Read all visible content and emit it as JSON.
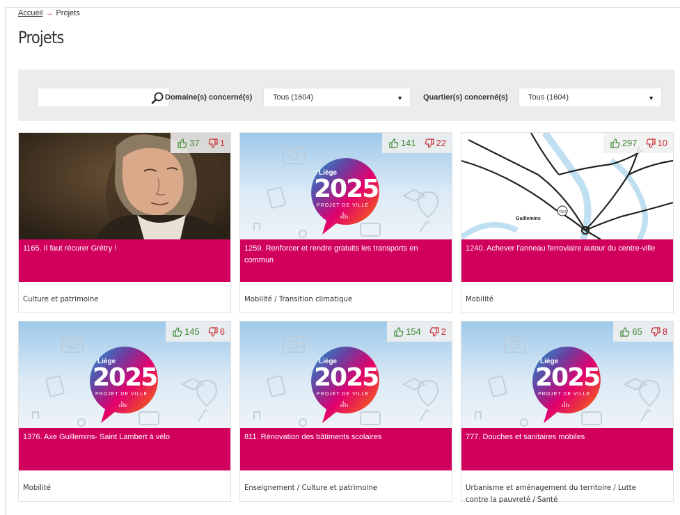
{
  "breadcrumb": {
    "home": "Accueil",
    "arrow": "→",
    "current": "Projets"
  },
  "page_title": "Projets",
  "filters": {
    "search_value": "",
    "domain_label": "Domaine(s) concerné(s)",
    "domain_value": "Tous (1604)",
    "district_label": "Quartier(s) concerné(s)",
    "district_value": "Tous (1604)"
  },
  "logo": {
    "line1": "Liège",
    "line2": "2025",
    "line3": "PROJET DE VILLE"
  },
  "map_labels": [
    "Guillemins",
    "TGV"
  ],
  "cards": [
    {
      "title": "1165. Il faut récurer Grétry !",
      "domain": "Culture et patrimoine",
      "up": "37",
      "down": "1",
      "image": "portrait"
    },
    {
      "title": "1259. Renforcer et rendre gratuits les transports en commun",
      "domain": "Mobilité / Transition climatique",
      "up": "141",
      "down": "22",
      "image": "logo"
    },
    {
      "title": "1240. Achever l'anneau ferroviaire autour du centre-ville",
      "domain": "Mobilité",
      "up": "297",
      "down": "10",
      "image": "map"
    },
    {
      "title": "1376. Axe Guillemins- Saint Lambert à vélo",
      "domain": "Mobilité",
      "up": "145",
      "down": "6",
      "image": "logo"
    },
    {
      "title": "811. Rénovation des bâtiments scolaires",
      "domain": "Enseignement / Culture et patrimoine",
      "up": "154",
      "down": "2",
      "image": "logo"
    },
    {
      "title": "777. Douches et sanitaires mobiles",
      "domain": "Urbanisme et aménagement du territoire / Lutte contre la pauvreté / Santé",
      "up": "65",
      "down": "8",
      "image": "logo"
    }
  ],
  "colors": {
    "accent": "#d1005d",
    "vote_up": "#3b8a2f",
    "vote_down": "#c9262d",
    "filter_bg": "#ececec"
  }
}
